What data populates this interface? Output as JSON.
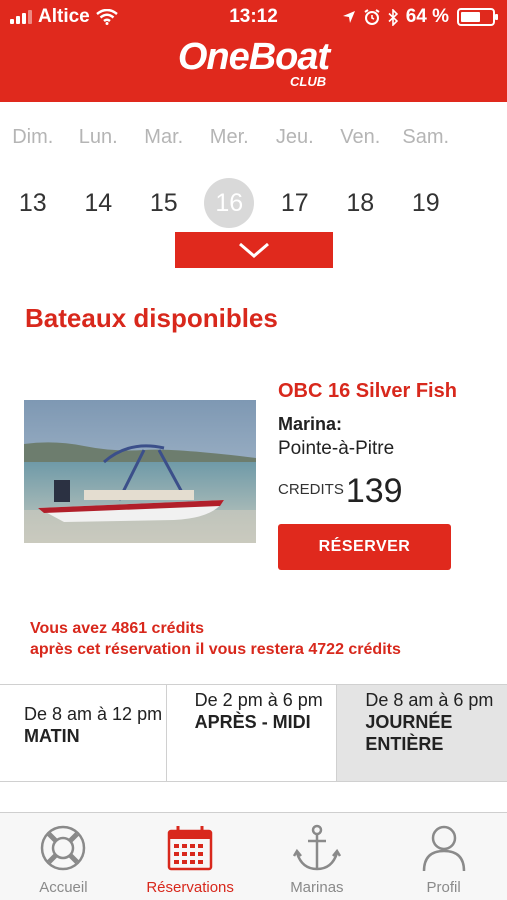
{
  "status_bar": {
    "carrier": "Altice",
    "time": "13:12",
    "battery": "64 %",
    "battery_level": 0.64
  },
  "header": {
    "logo_main": "OneBoat",
    "logo_sub": "CLUB",
    "brand_color": "#e0291d"
  },
  "calendar": {
    "days": [
      {
        "name": "Dim.",
        "number": "13"
      },
      {
        "name": "Lun.",
        "number": "14"
      },
      {
        "name": "Mar.",
        "number": "15"
      },
      {
        "name": "Mer.",
        "number": "16",
        "selected": true
      },
      {
        "name": "Jeu.",
        "number": "17"
      },
      {
        "name": "Ven.",
        "number": "18"
      },
      {
        "name": "Sam.",
        "number": "19"
      }
    ]
  },
  "section_title": "Bateaux disponibles",
  "boat": {
    "name": "OBC 16 Silver Fish",
    "marina_label": "Marina:",
    "marina_value": "Pointe-à-Pitre",
    "credits_label": "CREDITS",
    "credits_value": "139",
    "reserve_label": "RÉSERVER"
  },
  "info": {
    "line1": "Vous avez 4861 crédits",
    "line2": "après cet réservation il vous restera 4722 crédits"
  },
  "slots": [
    {
      "time": "De 8 am à 12 pm",
      "name": "MATIN"
    },
    {
      "time": "De 2 pm à 6 pm",
      "name": "APRÈS - MIDI"
    },
    {
      "time": "De 8 am à 6 pm",
      "name": "JOURNÉE ENTIÈRE",
      "selected": true
    }
  ],
  "tabs": [
    {
      "label": "Accueil",
      "icon": "lifebuoy-icon"
    },
    {
      "label": "Réservations",
      "icon": "calendar-icon",
      "active": true
    },
    {
      "label": "Marinas",
      "icon": "anchor-icon"
    },
    {
      "label": "Profil",
      "icon": "user-icon"
    }
  ]
}
